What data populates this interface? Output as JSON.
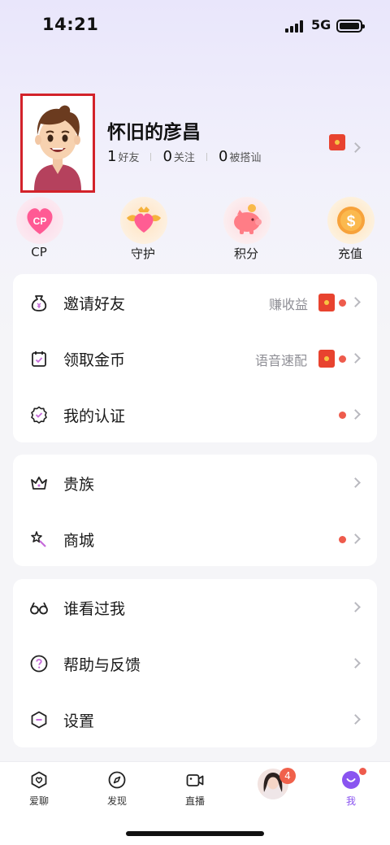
{
  "status_bar": {
    "time": "14:21",
    "network": "5G"
  },
  "profile": {
    "nickname": "怀旧的彦昌",
    "stats": [
      {
        "value": "1",
        "label": "好友"
      },
      {
        "value": "0",
        "label": "关注"
      },
      {
        "value": "0",
        "label": "被搭讪"
      }
    ]
  },
  "quick_actions": [
    {
      "label": "CP",
      "icon": "cp-heart-icon",
      "icon_text": "CP"
    },
    {
      "label": "守护",
      "icon": "guard-wings-icon"
    },
    {
      "label": "积分",
      "icon": "piggy-bank-icon"
    },
    {
      "label": "充值",
      "icon": "gold-coin-icon",
      "icon_text": "$"
    }
  ],
  "menu_groups": [
    [
      {
        "label": "邀请好友",
        "icon": "money-bag-icon",
        "hint": "赚收益",
        "red_packet": true,
        "dot": true
      },
      {
        "label": "领取金币",
        "icon": "calendar-icon",
        "hint": "语音速配",
        "red_packet": true,
        "dot": true
      },
      {
        "label": "我的认证",
        "icon": "verified-badge-icon",
        "hint": "",
        "red_packet": false,
        "dot": true
      }
    ],
    [
      {
        "label": "贵族",
        "icon": "crown-icon",
        "dot": false
      },
      {
        "label": "商城",
        "icon": "magic-wand-icon",
        "dot": true
      }
    ],
    [
      {
        "label": "谁看过我",
        "icon": "glasses-icon"
      },
      {
        "label": "帮助与反馈",
        "icon": "help-icon"
      },
      {
        "label": "设置",
        "icon": "settings-icon"
      }
    ]
  ],
  "tabbar": {
    "tabs": [
      {
        "label": "爱聊",
        "icon": "chat-heart-icon",
        "active": false
      },
      {
        "label": "发现",
        "icon": "compass-icon",
        "active": false
      },
      {
        "label": "直播",
        "icon": "video-camera-icon",
        "active": false
      },
      {
        "label": "",
        "icon": "user-avatar-icon",
        "badge": "4"
      },
      {
        "label": "我",
        "icon": "me-smile-icon",
        "active": true
      }
    ]
  },
  "colors": {
    "accent": "#8a54f0",
    "red_dot": "#ee5b4c",
    "frame_red": "#d3222a"
  }
}
